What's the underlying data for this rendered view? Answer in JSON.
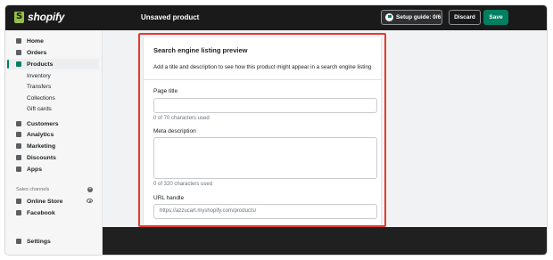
{
  "topbar": {
    "brand": "shopify",
    "page_status": "Unsaved product",
    "setup_guide": "Setup guide: 0/6",
    "discard": "Discard",
    "save": "Save"
  },
  "sidebar": {
    "items": [
      {
        "label": "Home",
        "icon": "home-icon"
      },
      {
        "label": "Orders",
        "icon": "orders-icon"
      },
      {
        "label": "Products",
        "icon": "tag-icon",
        "active": true
      }
    ],
    "product_subitems": [
      "Inventory",
      "Transfers",
      "Collections",
      "Gift cards"
    ],
    "items2": [
      {
        "label": "Customers",
        "icon": "person-icon"
      },
      {
        "label": "Analytics",
        "icon": "bar-chart-icon"
      },
      {
        "label": "Marketing",
        "icon": "target-icon"
      },
      {
        "label": "Discounts",
        "icon": "discount-icon"
      },
      {
        "label": "Apps",
        "icon": "apps-icon"
      }
    ],
    "sales_channels_label": "Sales channels",
    "channels": [
      {
        "label": "Online Store",
        "icon": "store-icon"
      },
      {
        "label": "Facebook",
        "icon": "facebook-icon"
      }
    ],
    "settings": "Settings"
  },
  "seo": {
    "title": "Search engine listing preview",
    "description": "Add a title and description to see how this product might appear in a search engine listing",
    "page_title_label": "Page title",
    "page_title_value": "",
    "page_title_hint": "0 of 70 characters used",
    "meta_label": "Meta description",
    "meta_value": "",
    "meta_hint": "0 of 320 characters used",
    "url_label": "URL handle",
    "url_value": "https://azzucart.myshopify.com/products/"
  },
  "colors": {
    "topbar": "#1a1a1a",
    "accent": "#008060",
    "highlight": "#e53a2f"
  }
}
